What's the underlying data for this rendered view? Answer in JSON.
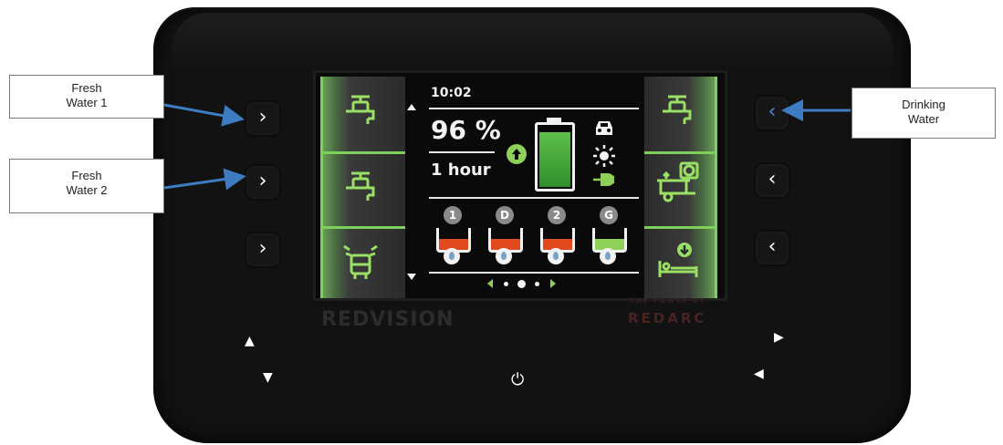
{
  "callouts": {
    "fresh_water_1": {
      "line1": "Fresh",
      "line2": "Water 1"
    },
    "fresh_water_2": {
      "line1": "Fresh",
      "line2": "Water 2"
    },
    "drinking_water": {
      "line1": "Drinking",
      "line2": "Water"
    }
  },
  "screen": {
    "time": "10:02",
    "battery_percent": "96 %",
    "remaining_time": "1 hour",
    "battery_level": 0.96,
    "tanks": [
      {
        "badge": "1",
        "level_color": "#e04a1e"
      },
      {
        "badge": "D",
        "level_color": "#e04a1e"
      },
      {
        "badge": "2",
        "level_color": "#e04a1e"
      },
      {
        "badge": "G",
        "level_color": "#8fd05a"
      }
    ],
    "page_dots": 3,
    "active_page": 2,
    "left_panel_icons": [
      "water-tap-icon",
      "water-tap-icon",
      "caravan-shower-icon"
    ],
    "right_panel_icons": [
      "water-tap-icon",
      "tank-timer-icon",
      "bed-download-icon"
    ],
    "source_icons": [
      "car-icon",
      "sun-icon",
      "plug-icon"
    ]
  },
  "device": {
    "brand_left": "REDVISION",
    "brand_right_top": "THE POWER OF",
    "brand_right": "REDARC",
    "power_symbol": "⏻"
  },
  "colors": {
    "accent_green": "#8fd05a",
    "warning_orange": "#e04a1e",
    "arrow_blue": "#3d7bc2",
    "bezel": "#121212"
  }
}
